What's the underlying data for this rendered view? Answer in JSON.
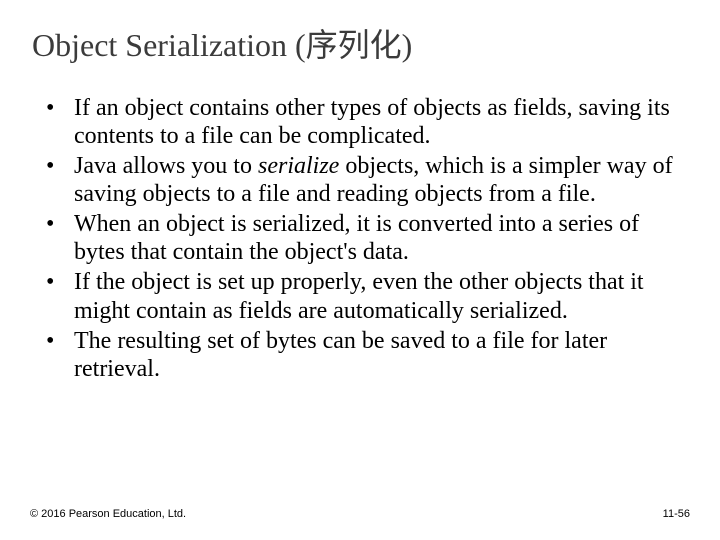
{
  "title": "Object Serialization (序列化)",
  "bullets": {
    "b1": "If an object contains other types of objects as fields, saving its contents to a file can be complicated.",
    "b2a": "Java allows you to ",
    "b2b": "serialize",
    "b2c": " objects, which is a simpler way of saving objects to a file and reading objects from a file.",
    "b3": "When an object is serialized, it is converted into a series of bytes that contain the object's data.",
    "b4": "If the object is set up properly, even the other objects that it might contain as fields are automatically serialized.",
    "b5": "The resulting set of bytes can be saved to a file for later retrieval."
  },
  "footer": {
    "copyright": "© 2016 Pearson Education, Ltd.",
    "pagenum": "11-56"
  }
}
